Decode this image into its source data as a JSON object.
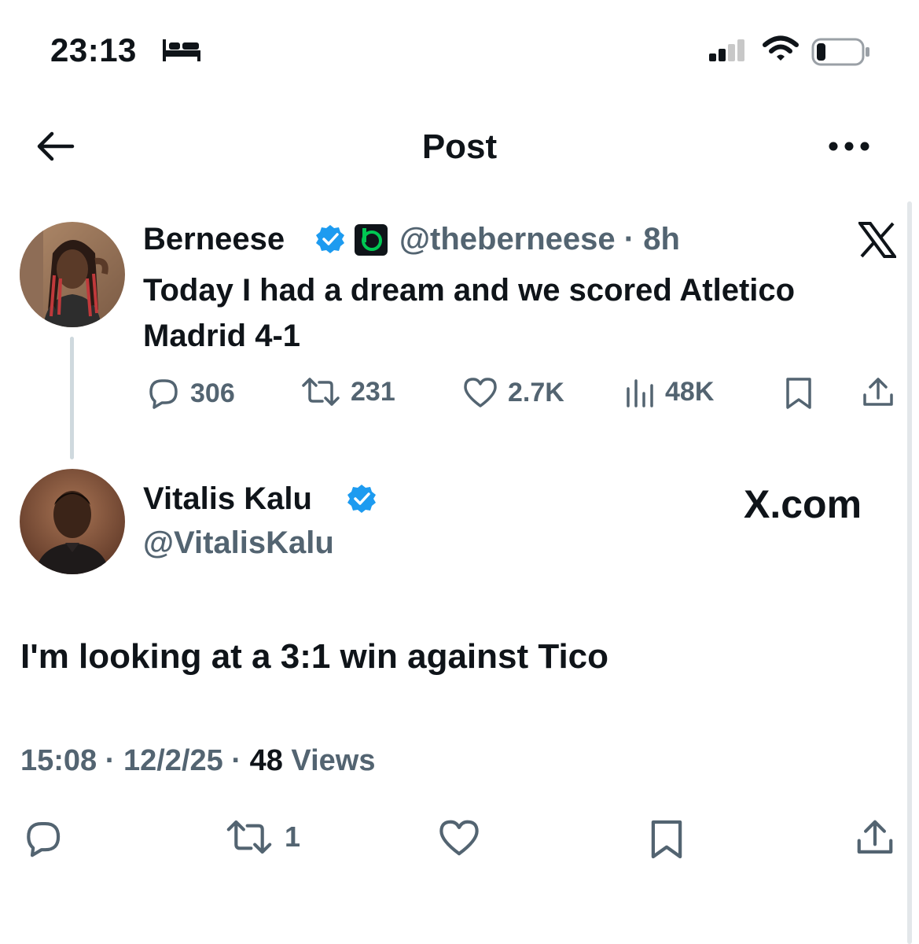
{
  "status_bar": {
    "time": "23:13",
    "bed_icon": "bed-icon",
    "signal_icon": "cellular-signal-icon",
    "wifi_icon": "wifi-icon",
    "battery_icon": "battery-low-icon",
    "battery_level": 0.15
  },
  "header": {
    "title": "Post",
    "back_icon": "arrow-left-icon",
    "more_icon": "more-horizontal-icon"
  },
  "quoted_post": {
    "name": "Berneese",
    "verified": true,
    "handle": "@theberneese",
    "separator": "·",
    "age": "8h",
    "text": "Today I had a dream and we scored Atletico Madrid 4-1",
    "actions": {
      "replies": "306",
      "reposts": "231",
      "likes": "2.7K",
      "views": "48K"
    }
  },
  "reply_post": {
    "name": "Vitalis Kalu",
    "verified": true,
    "handle": "@VitalisKalu",
    "watermark": "X.com",
    "text": "I'm looking at a 3:1 win against Tico",
    "time": "15:08",
    "date": "12/2/25",
    "views_count": "48",
    "views_label": "Views",
    "separator": "·",
    "actions": {
      "reposts": "1"
    }
  },
  "colors": {
    "text": "#0f1419",
    "secondary": "#536471",
    "verified_blue": "#1d9bf0",
    "app_badge_green": "#00c853"
  }
}
